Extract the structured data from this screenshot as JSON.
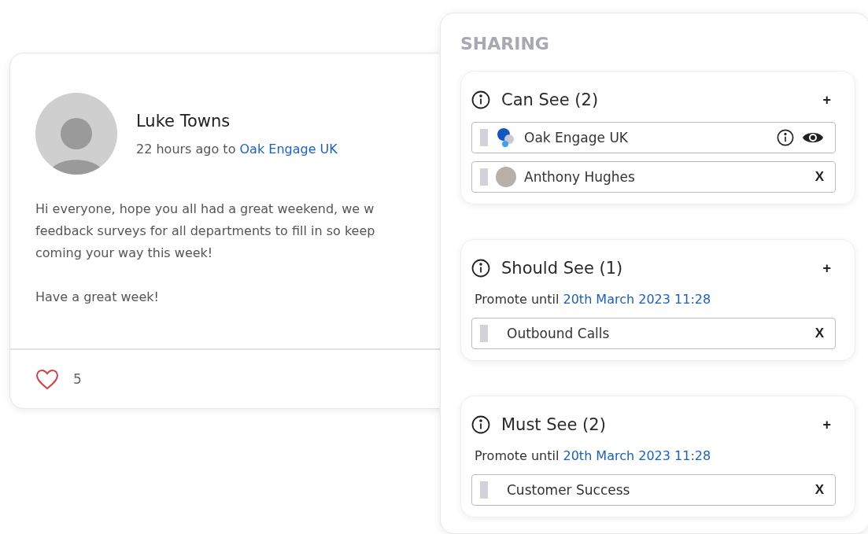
{
  "post": {
    "author": "Luke Towns",
    "time": "22 hours ago to",
    "audience": "Oak Engage UK",
    "body_lines": [
      "Hi everyone, hope you all had a great weekend, we w",
      "feedback surveys for all departments to fill in so keep",
      "coming your way this week!"
    ],
    "closing": "Have a great week!",
    "likes": "5",
    "liked": false
  },
  "sharing": {
    "title": "SHARING",
    "sections": [
      {
        "heading": "Can See (2)",
        "add": "+",
        "items": [
          {
            "kind": "group",
            "label": "Oak Engage UK"
          },
          {
            "kind": "person",
            "label": "Anthony Hughes",
            "remove": "X"
          }
        ]
      },
      {
        "heading": "Should See (1)",
        "add": "+",
        "promote_label": "Promote until",
        "promote_date": "20th March 2023 11:28",
        "items": [
          {
            "kind": "plain",
            "label": "Outbound Calls",
            "remove": "X"
          }
        ]
      },
      {
        "heading": "Must See (2)",
        "add": "+",
        "promote_label": "Promote until",
        "promote_date": "20th March 2023 11:28",
        "items": [
          {
            "kind": "plain",
            "label": "Customer Success",
            "remove": "X"
          }
        ]
      }
    ]
  }
}
